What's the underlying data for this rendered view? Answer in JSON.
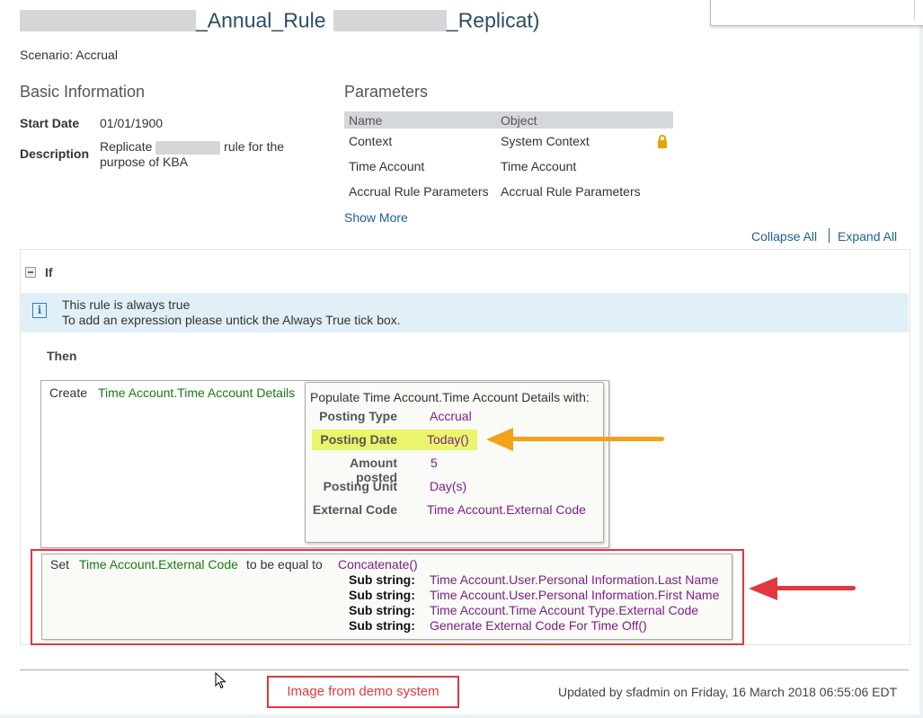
{
  "header": {
    "title_part1": "_Annual_Rule",
    "title_part2": "_Replicat)",
    "scenario": "Scenario: Accrual"
  },
  "basic_info": {
    "heading": "Basic Information",
    "start_date_label": "Start Date",
    "start_date_value": "01/01/1900",
    "description_label": "Description",
    "description_part1": "Replicate",
    "description_part2": "rule for the",
    "description_line2": "purpose of KBA"
  },
  "parameters": {
    "heading": "Parameters",
    "col_name": "Name",
    "col_object": "Object",
    "rows": [
      {
        "name": "Context",
        "object": "System Context",
        "locked": true
      },
      {
        "name": "Time Account",
        "object": "Time Account",
        "locked": false
      },
      {
        "name": "Accrual Rule Parameters",
        "object": "Accrual Rule Parameters",
        "locked": false
      }
    ],
    "show_more": "Show More"
  },
  "controls": {
    "collapse_all": "Collapse All",
    "expand_all": "Expand All"
  },
  "if_section": {
    "label": "If",
    "info_line1": "This rule is always true",
    "info_line2": "To add an expression please untick the Always True tick box."
  },
  "then_section": {
    "label": "Then",
    "create_label": "Create",
    "create_target": "Time Account.Time Account Details",
    "populate_heading": "Populate Time Account.Time Account Details with:",
    "fields": [
      {
        "label": "Posting Type",
        "value": "Accrual"
      },
      {
        "label": "Posting Date",
        "value": "Today()"
      },
      {
        "label": "Amount posted",
        "value": "5"
      },
      {
        "label": "Posting Unit",
        "value": "Day(s)"
      },
      {
        "label": "External Code",
        "value": "Time Account.External Code"
      }
    ],
    "set_label": "Set",
    "set_target": "Time Account.External Code",
    "set_middle": "to be equal to",
    "set_function": "Concatenate()",
    "substrings": [
      {
        "label": "Sub string:",
        "value": "Time Account.User.Personal Information.Last Name"
      },
      {
        "label": "Sub string:",
        "value": "Time Account.User.Personal Information.First Name"
      },
      {
        "label": "Sub string:",
        "value": "Time Account.Time Account Type.External Code"
      },
      {
        "label": "Sub string:",
        "value": "Generate External Code For Time Off()"
      }
    ]
  },
  "footer": {
    "demo_note": "Image from demo system",
    "updated": "Updated by sfadmin on Friday, 16 March 2018 06:55:06 EDT"
  },
  "colors": {
    "title": "#2b4d66",
    "link": "#1f5f8f",
    "field_green": "#177a17",
    "value_purple": "#7c2086",
    "highlight": "#ebf56b",
    "arrow_orange": "#f3a21a",
    "annotation_red": "#e0383e",
    "info_bg": "#e1f0f7"
  }
}
